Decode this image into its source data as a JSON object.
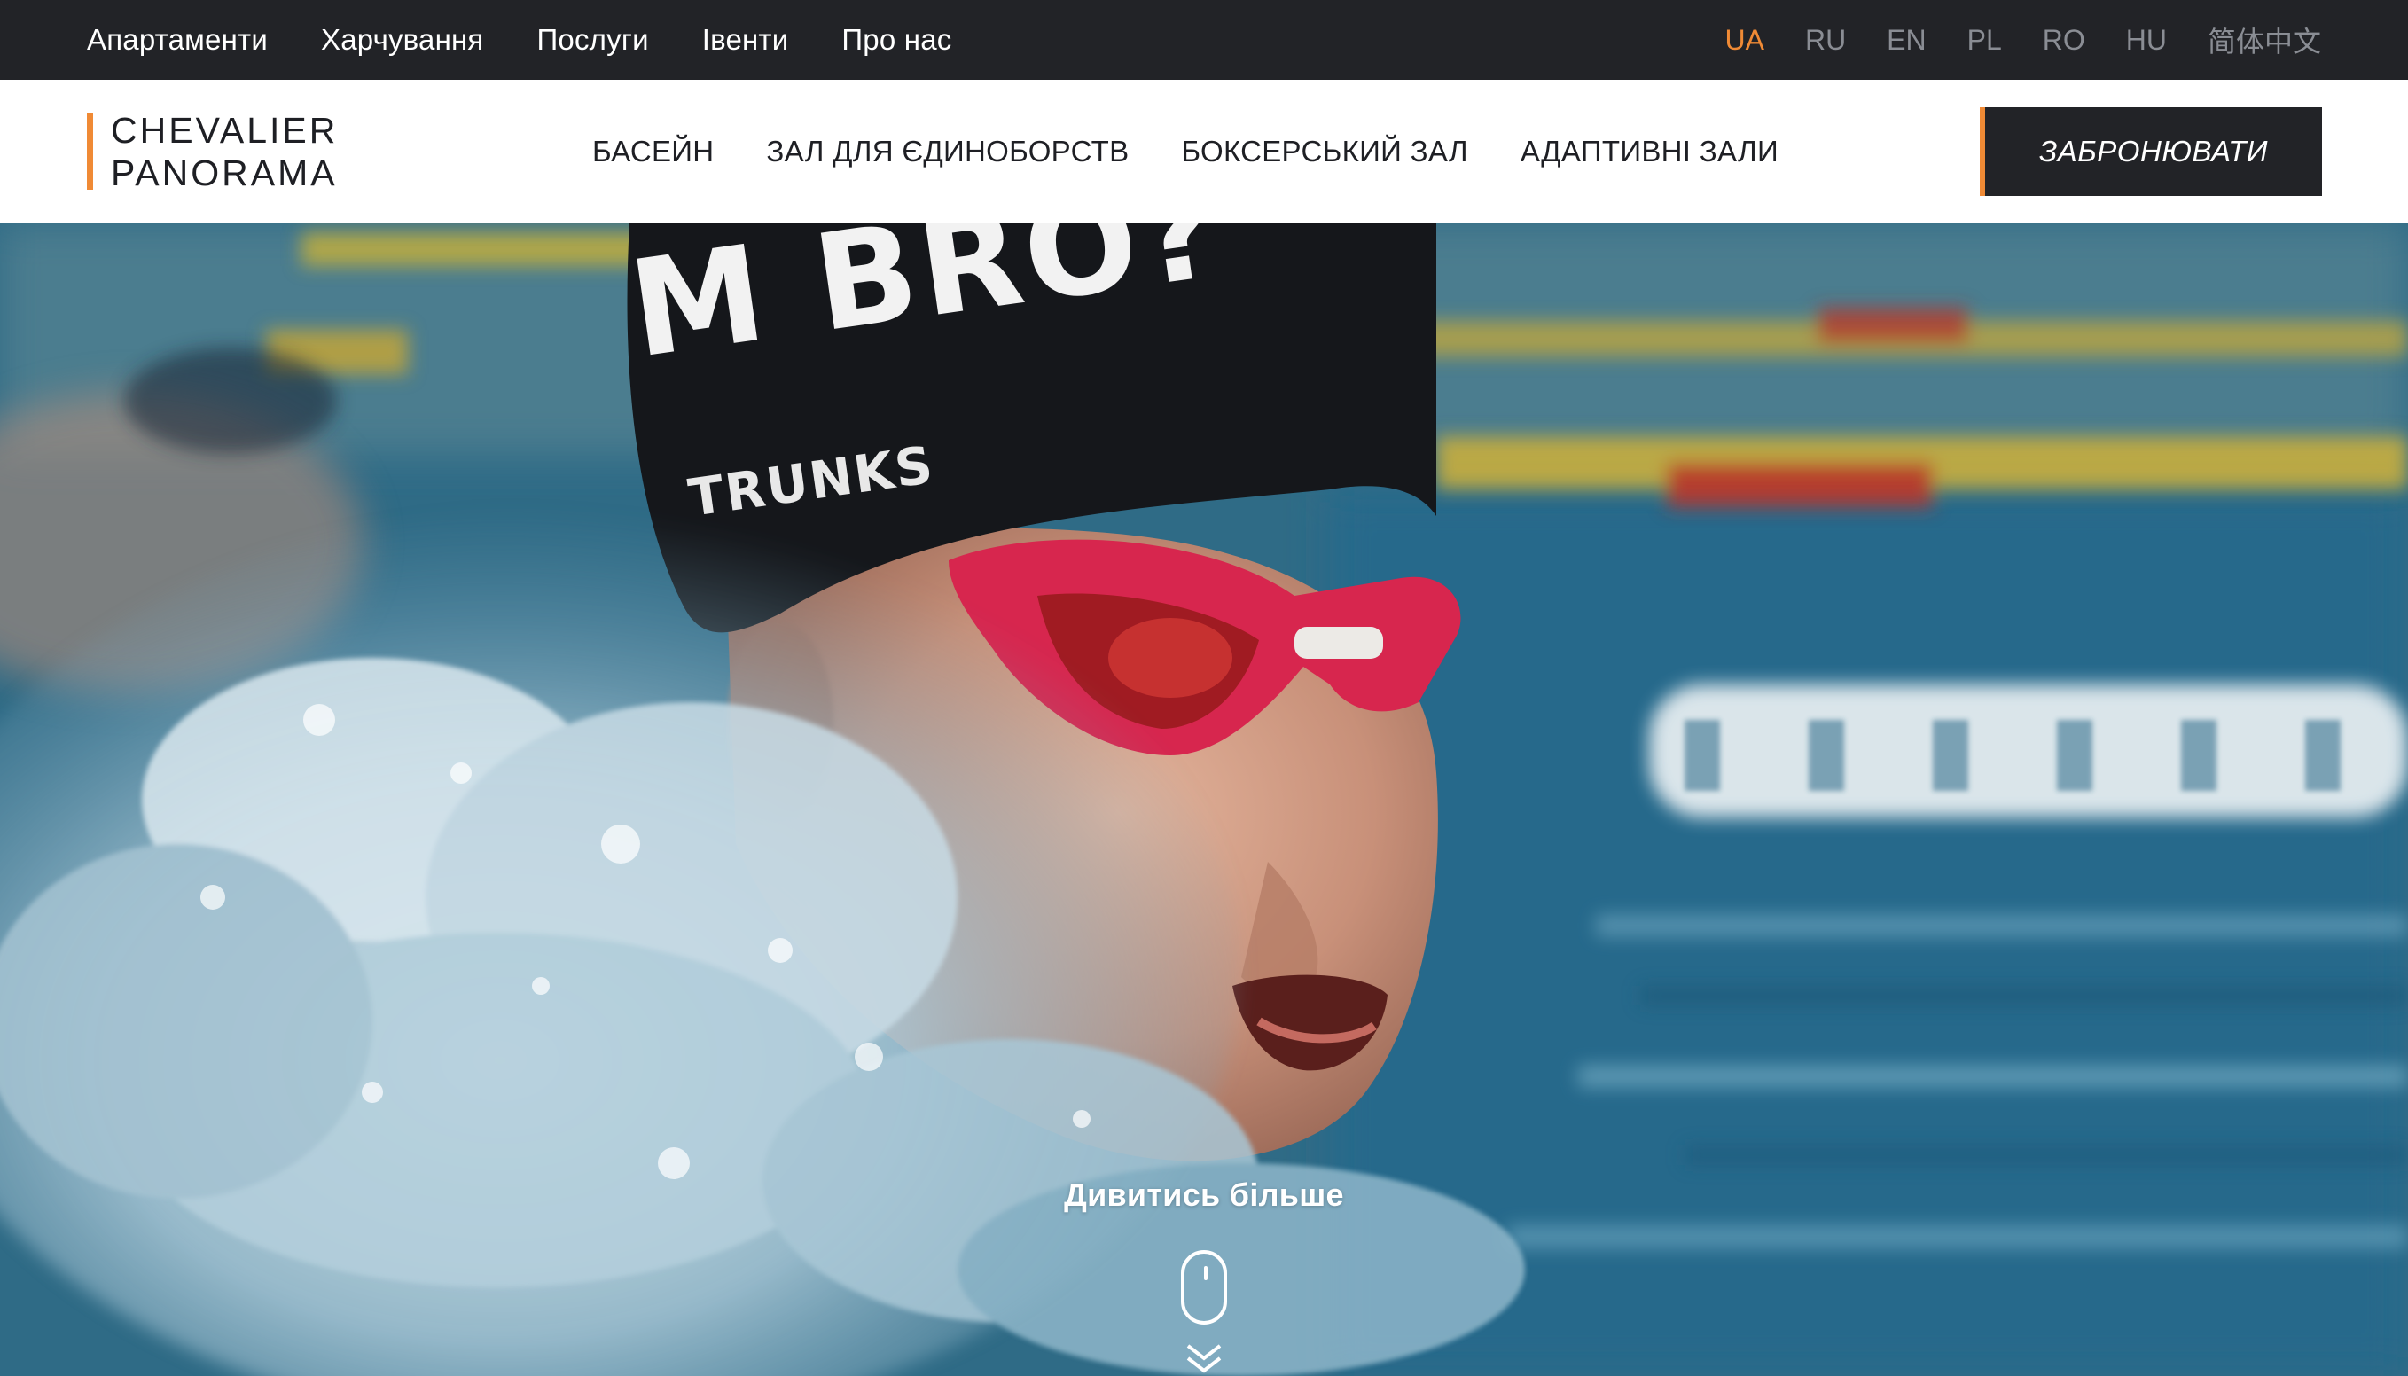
{
  "topbar": {
    "nav": [
      {
        "label": "Апартаменти"
      },
      {
        "label": "Харчування"
      },
      {
        "label": "Послуги"
      },
      {
        "label": "Івенти"
      },
      {
        "label": "Про нас"
      }
    ],
    "languages": [
      {
        "code": "UA",
        "active": true
      },
      {
        "code": "RU",
        "active": false
      },
      {
        "code": "EN",
        "active": false
      },
      {
        "code": "PL",
        "active": false
      },
      {
        "code": "RO",
        "active": false
      },
      {
        "code": "HU",
        "active": false
      },
      {
        "code": "简体中文",
        "active": false
      }
    ]
  },
  "header": {
    "logo": {
      "line1": "CHEVALIER",
      "line2": "PANORAMA"
    },
    "nav": [
      {
        "label": "БАСЕЙН"
      },
      {
        "label": "ЗАЛ ДЛЯ ЄДИНОБОРСТВ"
      },
      {
        "label": "БОКСЕРСЬКИЙ ЗАЛ"
      },
      {
        "label": "АДАПТИВНІ ЗАЛИ"
      }
    ],
    "book_button": "ЗАБРОНЮВАТИ"
  },
  "hero": {
    "cap_text_line1": "M BRO?",
    "cap_text_line2": "TRUNKS",
    "cta_label": "Дивитись більше",
    "scroll_icon": "mouse-icon",
    "scroll_arrow_icon": "double-chevron-down-icon"
  },
  "colors": {
    "accent": "#f08a35",
    "dark": "#222327",
    "lang_inactive": "#8a8d94"
  }
}
